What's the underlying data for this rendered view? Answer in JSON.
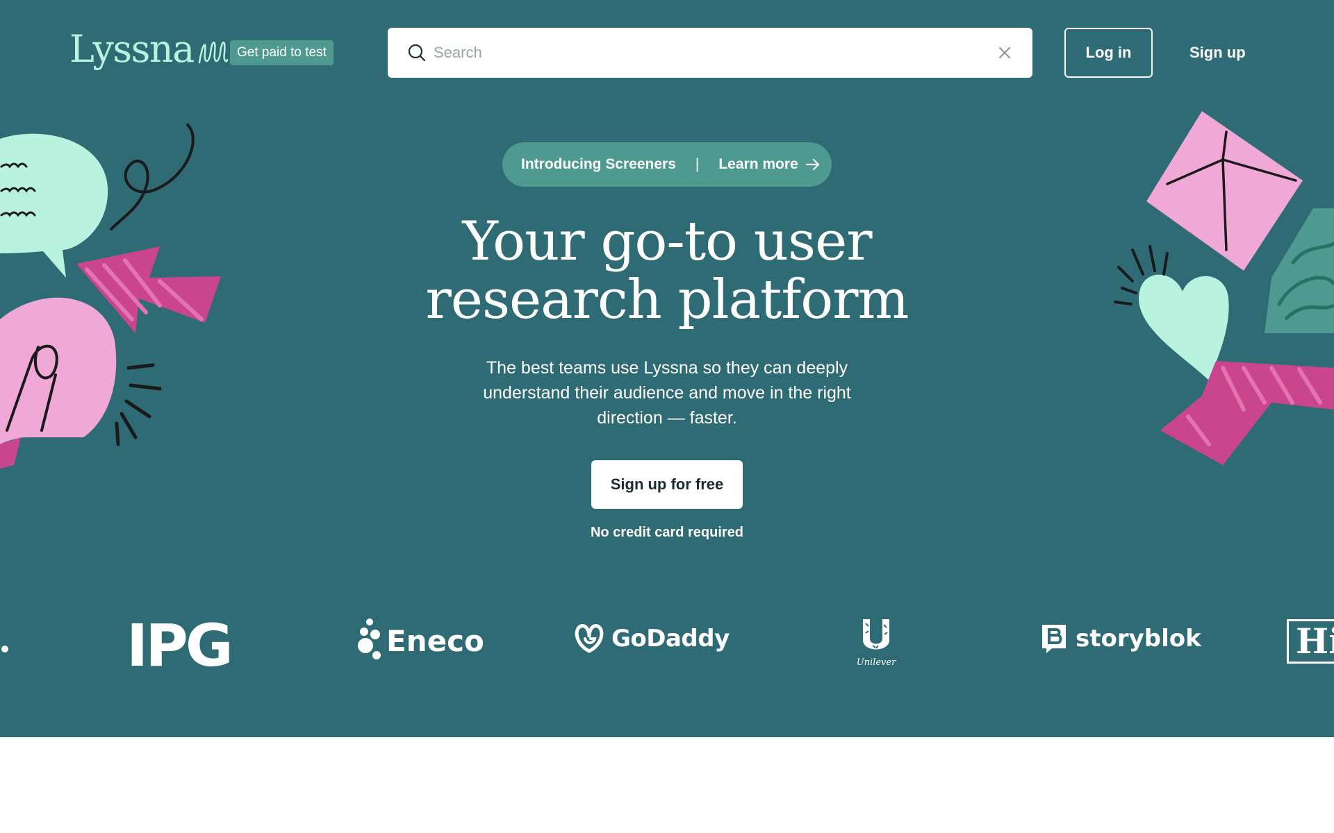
{
  "header": {
    "logo_text": "Lyssna",
    "badge_label": "Get paid to test",
    "search_placeholder": "Search",
    "login_label": "Log in",
    "signup_label": "Sign up"
  },
  "announcement": {
    "intro": "Introducing Screeners",
    "divider": "|",
    "link_label": "Learn more"
  },
  "hero": {
    "headline": "Your go-to user research platform",
    "subtext": "The best teams use Lyssna so they can deeply understand their audience and move in the right direction — faster.",
    "cta_label": "Sign up for free",
    "cta_note": "No credit card required"
  },
  "customer_logos": {
    "ipg": "IPG",
    "eneco": "Eneco",
    "godaddy": "GoDaddy",
    "unilever": "Unilever",
    "storyblok": "storyblok",
    "partial": "Hi"
  },
  "colors": {
    "hero_background": "#2f6b74",
    "accent_teal": "#4f9a90",
    "mint": "#b9f3df",
    "pink": "#f0a9d6",
    "magenta": "#c9468e"
  },
  "icons": [
    "search-icon",
    "clear-icon",
    "arrow-right-icon"
  ]
}
